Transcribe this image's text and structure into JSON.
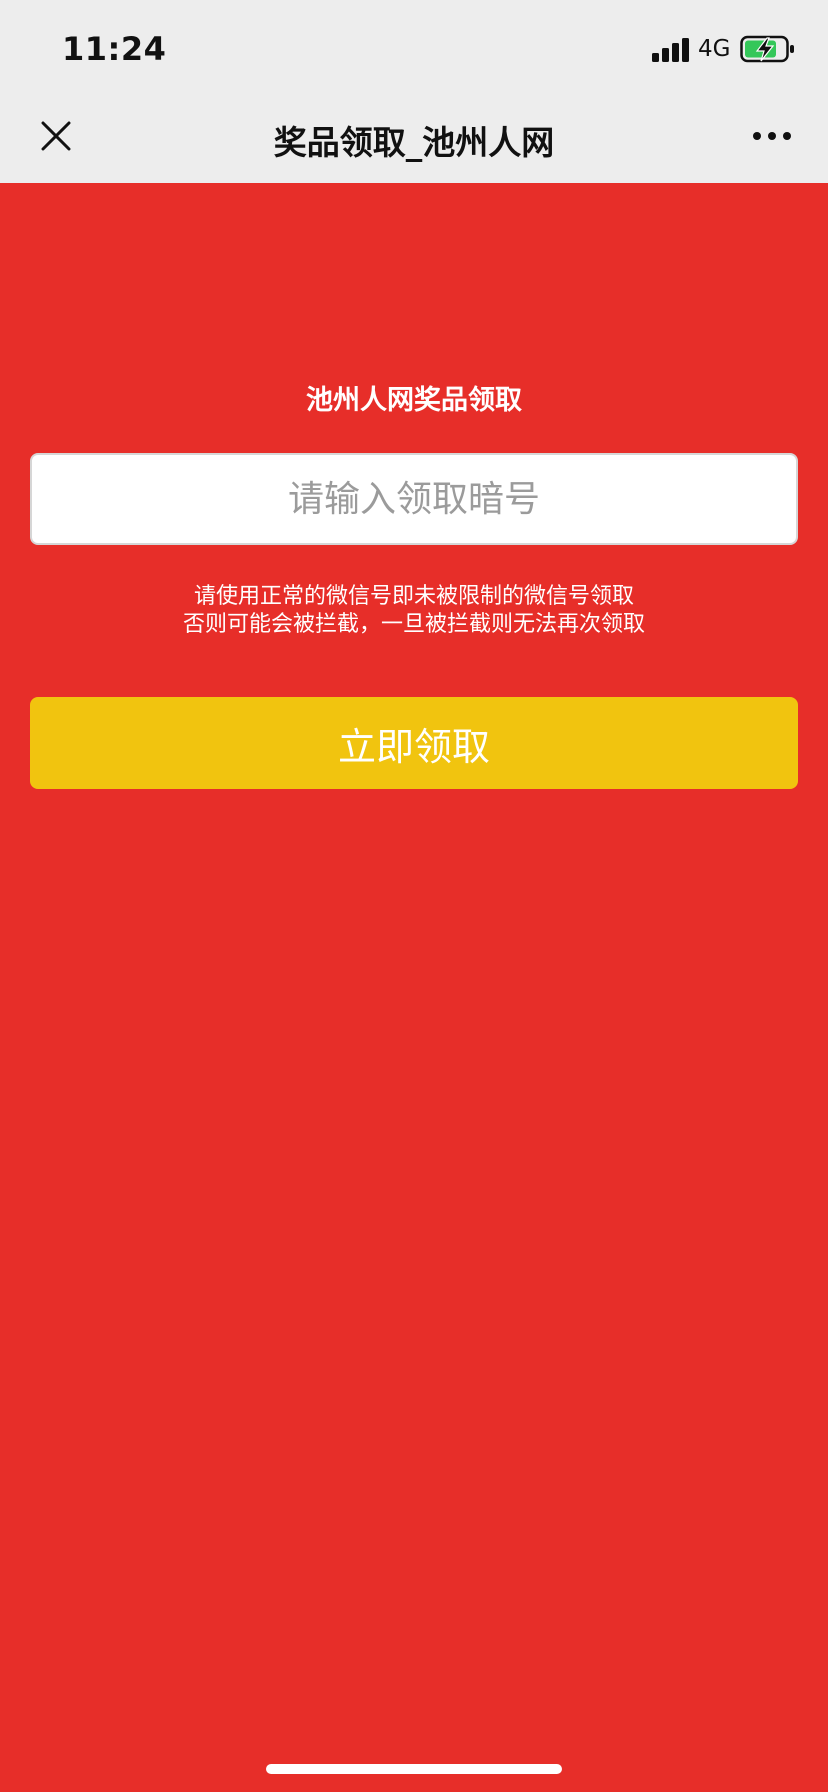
{
  "status_bar": {
    "time": "11:24",
    "network": "4G",
    "icons": [
      "signal-icon",
      "battery-charging-icon"
    ]
  },
  "nav": {
    "title": "奖品领取_池州人网",
    "close_icon": "close-icon",
    "more_icon": "more-icon"
  },
  "page": {
    "heading": "池州人网奖品领取",
    "code_input": {
      "placeholder": "请输入领取暗号",
      "value": ""
    },
    "notice_lines": [
      "请使用正常的微信号即未被限制的微信号领取",
      "否则可能会被拦截，一旦被拦截则无法再次领取"
    ],
    "claim_button_label": "立即领取"
  },
  "colors": {
    "background": "#e72e29",
    "top_chrome": "#ededed",
    "button": "#f1c40f",
    "text_on_red": "#ffffff",
    "battery_fill": "#34c759"
  }
}
